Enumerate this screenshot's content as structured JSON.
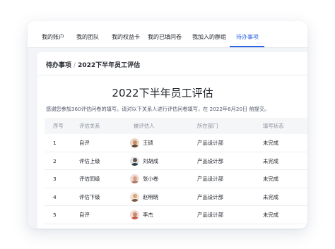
{
  "tabs": [
    {
      "label": "我的账户",
      "active": false
    },
    {
      "label": "我的团队",
      "active": false
    },
    {
      "label": "我的权益卡",
      "active": false
    },
    {
      "label": "我的已填问卷",
      "active": false
    },
    {
      "label": "我加入的群组",
      "active": false
    },
    {
      "label": "待办事项",
      "active": true
    }
  ],
  "breadcrumb": {
    "parent": "待办事项",
    "separator": "/",
    "current": "2022下半年员工评估"
  },
  "page": {
    "title": "2022下半年员工评估",
    "description": "感谢您参加360评估问卷的填写。请对以下关系人进行评估问卷填写，在 2022年6月20日 前提交。"
  },
  "table": {
    "headers": [
      "序号",
      "评估关系",
      "被评估人",
      "所在部门",
      "填写状态"
    ],
    "rows": [
      {
        "index": "1",
        "relation": "自评",
        "person": "王硕",
        "avatar": "avatar-1",
        "department": "产品设计部",
        "status": "未完成"
      },
      {
        "index": "2",
        "relation": "评估上级",
        "person": "刘胡成",
        "avatar": "avatar-2",
        "department": "产品设计部",
        "status": "未完成"
      },
      {
        "index": "3",
        "relation": "评估同级",
        "person": "张小卷",
        "avatar": "avatar-3",
        "department": "产品设计部",
        "status": "未完成"
      },
      {
        "index": "4",
        "relation": "评估下级",
        "person": "赵明晓",
        "avatar": "avatar-4",
        "department": "产品设计部",
        "status": "未完成"
      },
      {
        "index": "5",
        "relation": "自评",
        "person": "李杰",
        "avatar": "avatar-5",
        "department": "产品设计部",
        "status": "未完成"
      }
    ]
  },
  "colors": {
    "accent": "#2b63e8",
    "text": "#1f2329",
    "muted": "#8a909c",
    "background": "#f2f4f8"
  }
}
